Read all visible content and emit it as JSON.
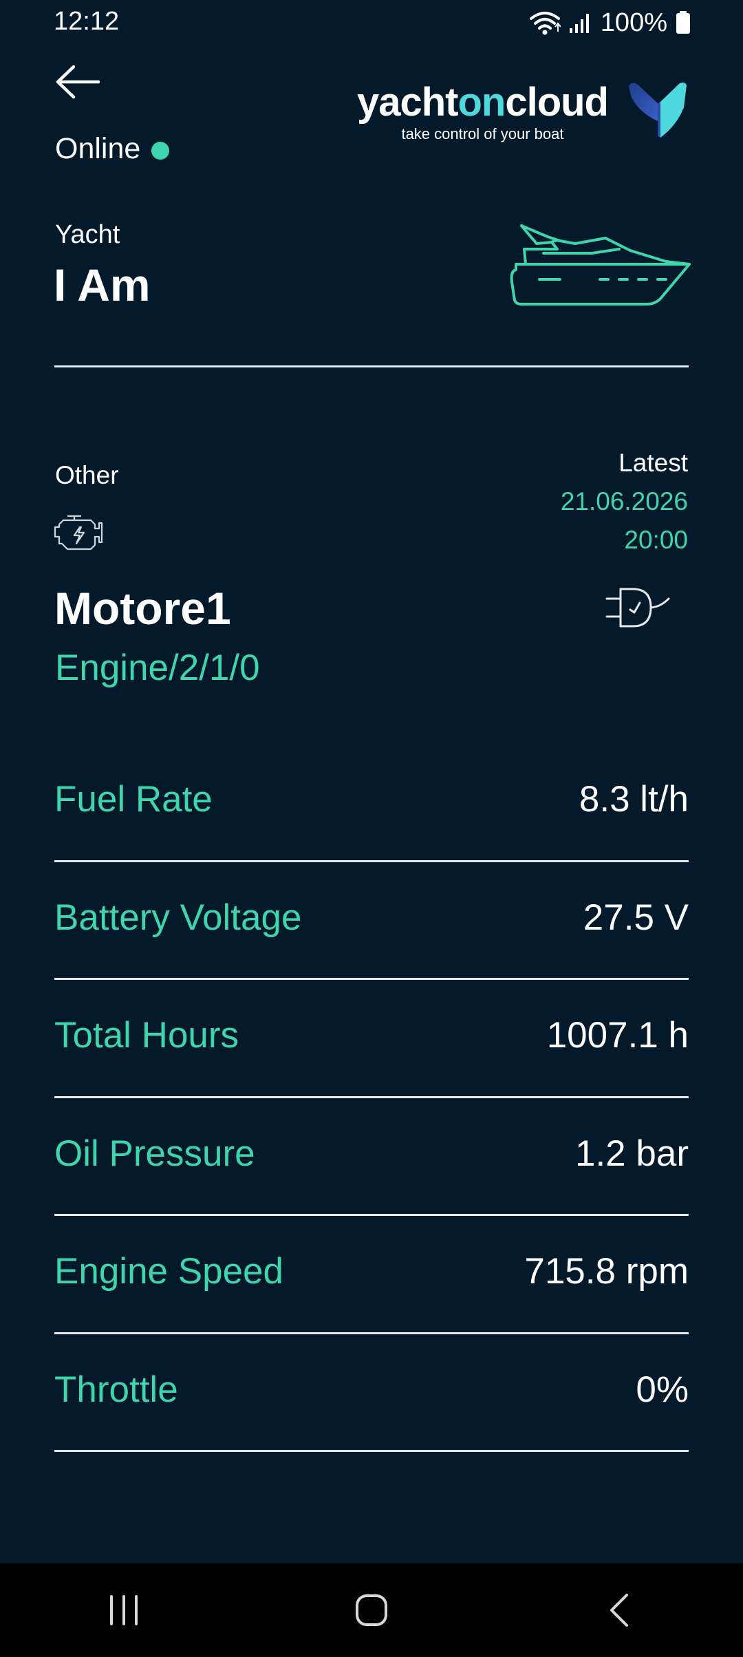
{
  "status_bar": {
    "time": "12:12",
    "battery": "100%",
    "icons": [
      "wifi-icon",
      "signal-icon",
      "battery-icon"
    ]
  },
  "header": {
    "back_icon": "back-arrow-icon",
    "online_label": "Online",
    "online_color": "#3fd6ad",
    "logo": {
      "word_a": "yacht",
      "word_b": "on",
      "word_c": "cloud",
      "tagline": "take control of your boat"
    }
  },
  "yacht": {
    "label": "Yacht",
    "name": "I Am",
    "icon": "yacht-icon"
  },
  "device": {
    "category": "Other",
    "category_icon": "engine-icon",
    "latest_label": "Latest",
    "latest_date": "21.06.2026",
    "latest_time": "20:00",
    "name": "Motore1",
    "path": "Engine/2/1/0",
    "connection_icon": "plug-icon"
  },
  "readings": [
    {
      "label": "Fuel Rate",
      "value": "8.3 lt/h"
    },
    {
      "label": "Battery Voltage",
      "value": "27.5 V"
    },
    {
      "label": "Total Hours",
      "value": "1007.1 h"
    },
    {
      "label": "Oil Pressure",
      "value": "1.2 bar"
    },
    {
      "label": "Engine Speed",
      "value": "715.8 rpm"
    },
    {
      "label": "Throttle",
      "value": "0%"
    }
  ],
  "nav_bar": {
    "buttons": [
      "recent-apps-icon",
      "home-icon",
      "back-icon"
    ]
  },
  "colors": {
    "background": "#041a2b",
    "accent": "#3fd6ad",
    "logo_accent": "#4fd8dd",
    "text": "#ffffff"
  }
}
